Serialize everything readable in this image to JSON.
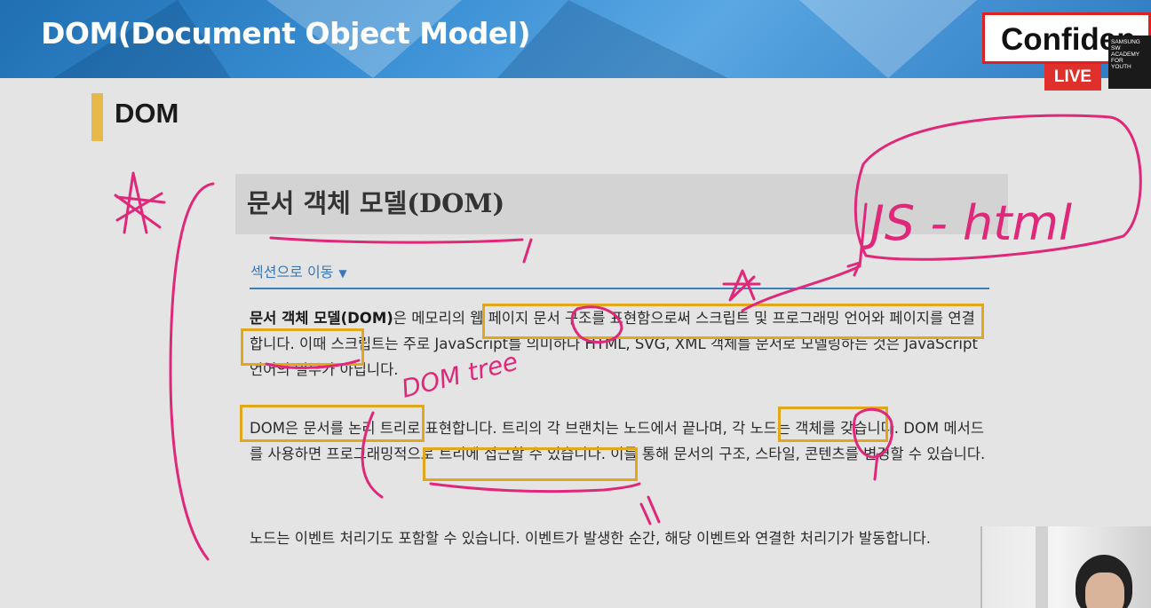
{
  "slide": {
    "title": "DOM(Document Object Model)",
    "section_title": "DOM"
  },
  "overlay": {
    "confidential_text": "Confiden",
    "live_badge": "LIVE",
    "logo_lines": [
      "SAMSUNG",
      "SW",
      "ACADEMY",
      "FOR",
      "YOUTH"
    ]
  },
  "document": {
    "heading": "문서 객체 모델(DOM)",
    "jump_link": "섹션으로 이동",
    "jump_caret": "▼",
    "para1_bold": "문서 객체 모델(DOM)",
    "para1_rest": "은 메모리의 웹 페이지 문서 구조를 표현함으로써 스크립트 및 프로그래밍 언어와 페이지를 연결합니다. 이때 스크립트는 주로 JavaScript를 의미하나 HTML, SVG, XML 객체를 문서로 모델링하는 것은 JavaScript 언어의 일부가 아닙니다.",
    "para2": "DOM은 문서를 논리 트리로 표현합니다. 트리의 각 브랜치는 노드에서 끝나며, 각 노드는 객체를 갖습니다. DOM 메서드를 사용하면 프로그래밍적으로 트리에 접근할 수 있습니다. 이를 통해 문서의 구조, 스타일, 콘텐츠를 변경할 수 있습니다.",
    "para3": "노드는 이벤트 처리기도 포함할 수 있습니다. 이벤트가 발생한 순간, 해당 이벤트와 연결한 처리기가 발동합니다."
  },
  "annotations": {
    "handwritten_note": "JS - html",
    "handwritten_tree": "DOM tree"
  },
  "colors": {
    "header_blue": "#2d79c0",
    "highlight_orange": "#e3a71c",
    "ink_pink": "#e0287a",
    "live_red": "#e0302b",
    "section_marker": "#e6b94a"
  }
}
